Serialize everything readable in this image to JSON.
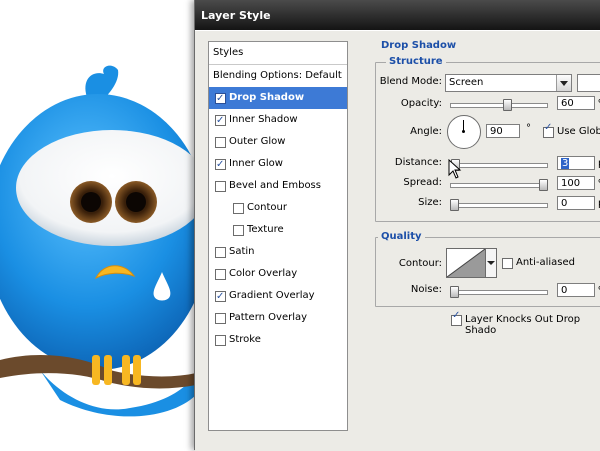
{
  "window": {
    "title": "Layer Style"
  },
  "styles_list": {
    "header": "Styles",
    "blending": "Blending Options: Default",
    "items": [
      {
        "label": "Drop Shadow",
        "checked": true,
        "selected": true,
        "indent": false
      },
      {
        "label": "Inner Shadow",
        "checked": true,
        "selected": false,
        "indent": false
      },
      {
        "label": "Outer Glow",
        "checked": false,
        "selected": false,
        "indent": false
      },
      {
        "label": "Inner Glow",
        "checked": true,
        "selected": false,
        "indent": false
      },
      {
        "label": "Bevel and Emboss",
        "checked": false,
        "selected": false,
        "indent": false
      },
      {
        "label": "Contour",
        "checked": false,
        "selected": false,
        "indent": true
      },
      {
        "label": "Texture",
        "checked": false,
        "selected": false,
        "indent": true
      },
      {
        "label": "Satin",
        "checked": false,
        "selected": false,
        "indent": false
      },
      {
        "label": "Color Overlay",
        "checked": false,
        "selected": false,
        "indent": false
      },
      {
        "label": "Gradient Overlay",
        "checked": true,
        "selected": false,
        "indent": false
      },
      {
        "label": "Pattern Overlay",
        "checked": false,
        "selected": false,
        "indent": false
      },
      {
        "label": "Stroke",
        "checked": false,
        "selected": false,
        "indent": false
      }
    ]
  },
  "drop_shadow": {
    "title": "Drop Shadow",
    "structure": {
      "title": "Structure",
      "blend_mode_label": "Blend Mode:",
      "blend_mode_value": "Screen",
      "opacity_label": "Opacity:",
      "opacity_value": "60",
      "opacity_unit": "%",
      "opacity_level": 0.6,
      "angle_label": "Angle:",
      "angle_value": "90",
      "angle_unit": "°",
      "use_global_label": "Use Globa",
      "use_global_checked": true,
      "distance_label": "Distance:",
      "distance_value": "3",
      "distance_unit": "p",
      "distance_level": 0.01,
      "spread_label": "Spread:",
      "spread_value": "100",
      "spread_unit": "%",
      "spread_level": 1.0,
      "size_label": "Size:",
      "size_value": "0",
      "size_unit": "p",
      "size_level": 0.0
    },
    "quality": {
      "title": "Quality",
      "contour_label": "Contour:",
      "anti_aliased_label": "Anti-aliased",
      "anti_aliased_checked": false,
      "noise_label": "Noise:",
      "noise_value": "0",
      "noise_unit": "%",
      "noise_level": 0.0
    },
    "knockout_label": "Layer Knocks Out Drop Shado",
    "knockout_checked": true
  },
  "colors": {
    "selection": "#3d7ad6",
    "section_title": "#1c4fa8",
    "bird_blue": "#1a8fe3",
    "branch": "#6b4a2c",
    "beak": "#f7b722"
  }
}
